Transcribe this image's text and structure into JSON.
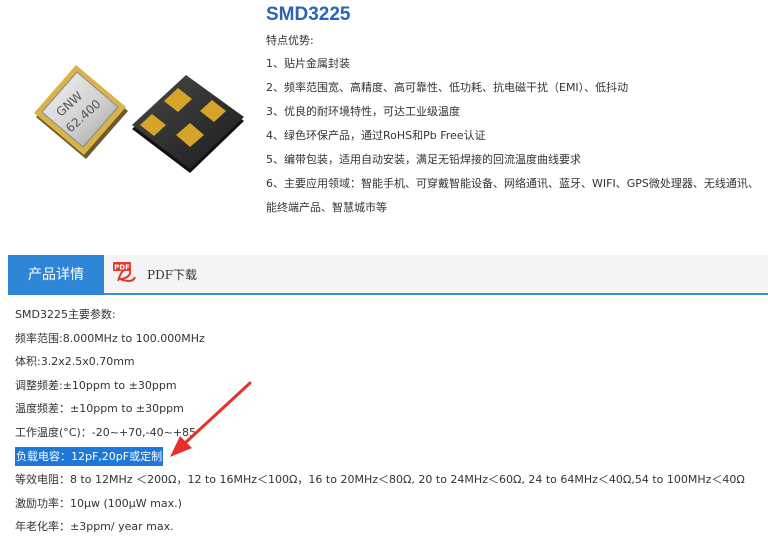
{
  "product": {
    "title": "SMD3225",
    "subtitle": "特点优势:",
    "chip_marking": [
      "GNW",
      "62.400"
    ],
    "features": [
      "1、贴片金属封装",
      "2、频率范围宽、高精度、高可靠性、低功耗、抗电磁干扰（EMI）、低抖动",
      "3、优良的耐环境特性，可达工业级温度",
      "4、绿色环保产品，通过RoHS和Pb Free认证",
      "5、编带包装，适用自动安装，满足无铅焊接的回流温度曲线要求",
      "6、主要应用领域：智能手机、可穿戴智能设备、网络通讯、蓝牙、WIFI、GPS微处理器、无线通讯、能终端产品、智慧城市等"
    ]
  },
  "tabs": {
    "details_label": "产品详情",
    "pdf_label": "PDF下载",
    "pdf_icon_text": "PDF"
  },
  "specs": [
    "SMD3225主要参数:",
    "频率范围:8.000MHz to 100.000MHz",
    "体积:3.2x2.5x0.70mm",
    "调整频差:±10ppm to ±30ppm",
    "温度频差：±10ppm to ±30ppm",
    "工作温度(°C)：-20~+70,-40~+85",
    "负载电容：12pF,20pF或定制",
    "等效电阻：8 to 12MHz ＜200Ω，12 to 16MHz＜100Ω，16 to 20MHz＜80Ω, 20 to 24MHz＜60Ω, 24 to 64MHz＜40Ω,54 to 100MHz＜40Ω",
    "激励功率：10μw (100μW max.)",
    "年老化率：±3ppm/ year max."
  ],
  "colors": {
    "title": "#2a63b8",
    "tab_active": "#2f86d6",
    "highlight": "#1e78d7",
    "annotation_arrow": "#e8302a",
    "pad_gold": "#d4a528"
  }
}
